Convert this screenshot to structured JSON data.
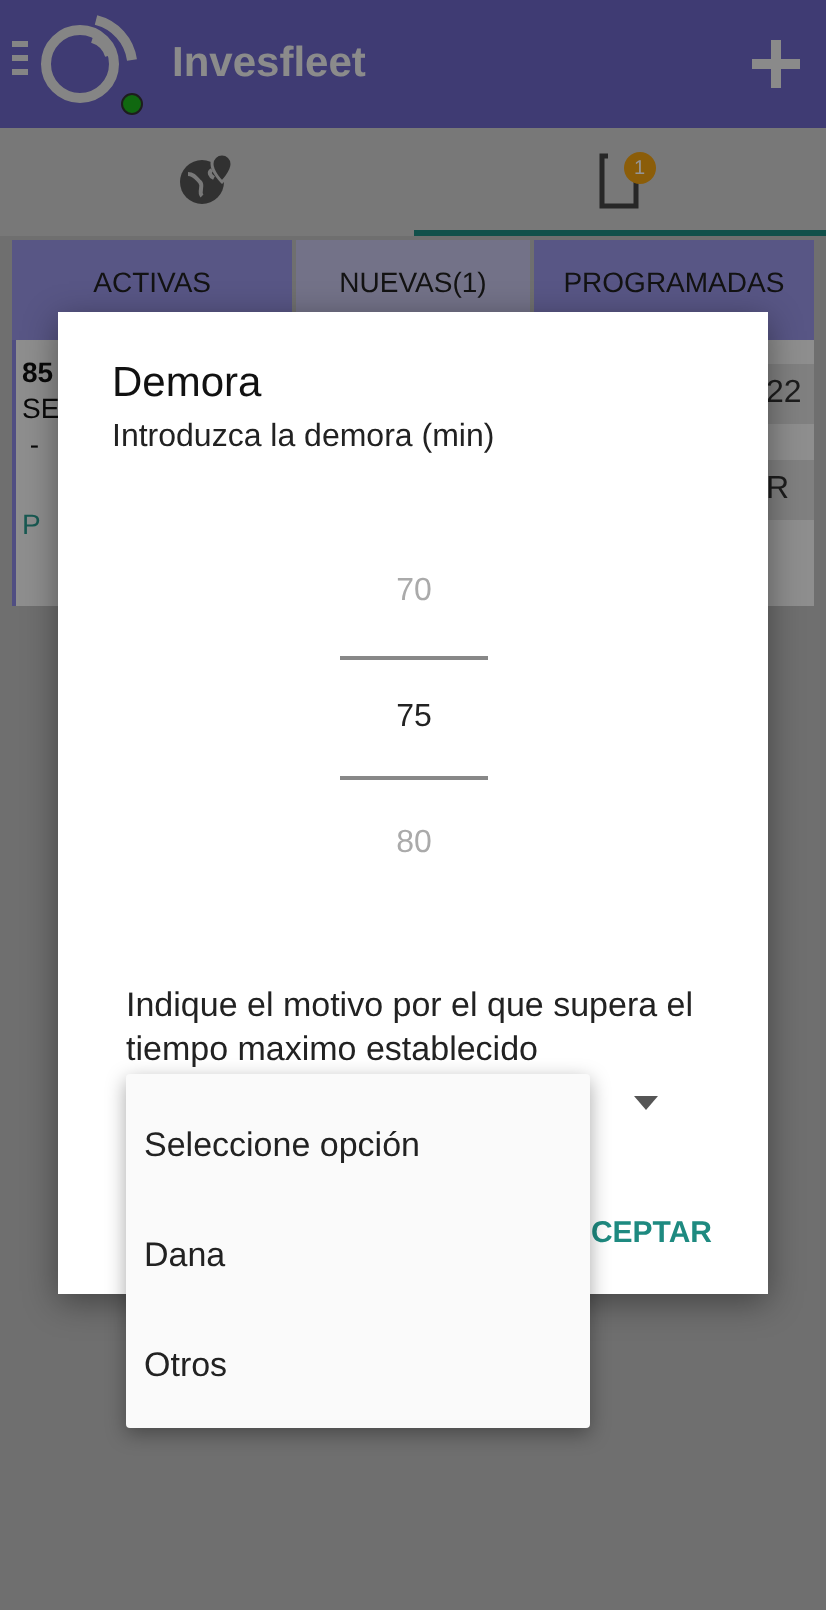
{
  "app_bar": {
    "title": "Invesfleet",
    "online": true
  },
  "nav_tabs": [
    {
      "kind": "map",
      "selected": false
    },
    {
      "kind": "orders",
      "selected": true,
      "badge": "1"
    }
  ],
  "order_tabs": [
    {
      "label": "ACTIVAS",
      "selected": false
    },
    {
      "label": "NUEVAS(1)",
      "selected": true
    },
    {
      "label": "PROGRAMADAS",
      "selected": false
    }
  ],
  "order_card": {
    "lines": [
      {
        "text": "85",
        "kind": "id"
      },
      {
        "text": "SE",
        "kind": "plain"
      },
      {
        "text": " -",
        "kind": "plain"
      },
      {
        "text": "P",
        "kind": "status"
      }
    ],
    "column_2": "22",
    "button": "R"
  },
  "dialog": {
    "title": "Demora",
    "subtitle": "Introduzca la demora (min)",
    "picker": [
      {
        "label": "70",
        "selected": false
      },
      {
        "label": "75",
        "selected": true
      },
      {
        "label": "80",
        "selected": false
      }
    ],
    "reason_prompt": "Indique el motivo por el que supera el tiempo maximo establecido",
    "button": "CEPTAR"
  },
  "dropdown_options": [
    "Seleccione opción",
    "Dana",
    "Otros"
  ]
}
